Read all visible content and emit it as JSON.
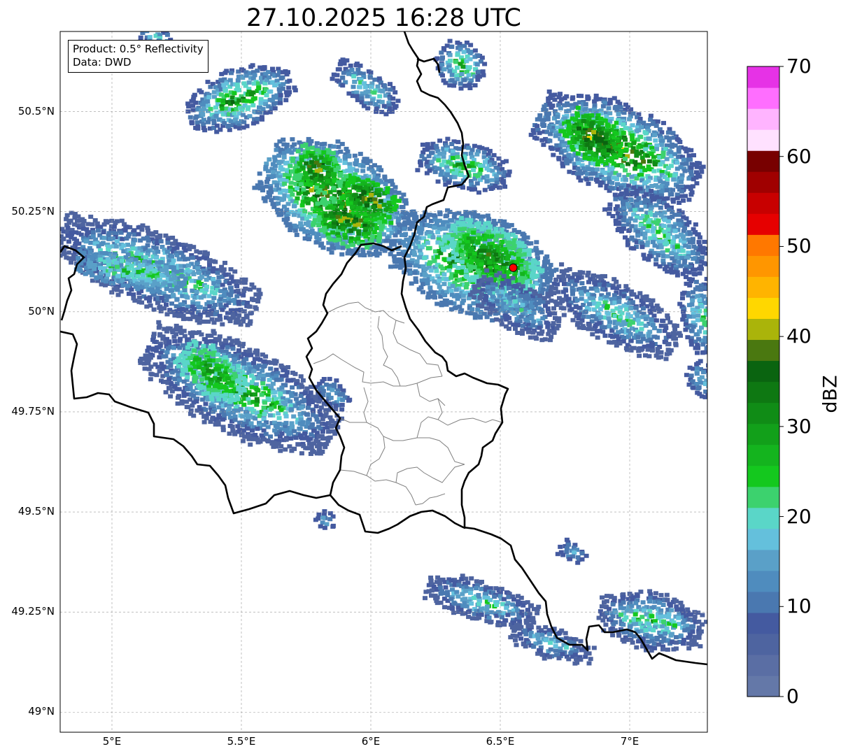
{
  "title": "27.10.2025 16:28 UTC",
  "info_box": {
    "product": "Product: 0.5° Reflectivity",
    "data_source": "Data: DWD"
  },
  "map": {
    "projection": "PlateCarree",
    "lon_range": [
      4.8,
      7.3
    ],
    "lat_range": [
      48.95,
      50.7
    ],
    "gridlines": true,
    "lat_ticks": [
      {
        "value": 49.0,
        "label": "49°N"
      },
      {
        "value": 49.25,
        "label": "49.25°N"
      },
      {
        "value": 49.5,
        "label": "49.5°N"
      },
      {
        "value": 49.75,
        "label": "49.75°N"
      },
      {
        "value": 50.0,
        "label": "50°N"
      },
      {
        "value": 50.25,
        "label": "50.25°N"
      },
      {
        "value": 50.5,
        "label": "50.5°N"
      }
    ],
    "lon_ticks": [
      {
        "value": 5.0,
        "label": "5°E"
      },
      {
        "value": 5.5,
        "label": "5.5°E"
      },
      {
        "value": 6.0,
        "label": "6°E"
      },
      {
        "value": 6.5,
        "label": "6.5°E"
      },
      {
        "value": 7.0,
        "label": "7°E"
      }
    ],
    "radar_site": {
      "lon": 6.55,
      "lat": 50.11,
      "color": "#ff0000"
    },
    "country_border_color": "#000000",
    "district_border_color": "#808080"
  },
  "colorbar": {
    "label": "dBZ",
    "range": [
      0,
      70
    ],
    "step": 2.5,
    "ticks": [
      {
        "value": 0,
        "label": "0"
      },
      {
        "value": 10,
        "label": "10"
      },
      {
        "value": 20,
        "label": "20"
      },
      {
        "value": 30,
        "label": "30"
      },
      {
        "value": 40,
        "label": "40"
      },
      {
        "value": 50,
        "label": "50"
      },
      {
        "value": 60,
        "label": "60"
      },
      {
        "value": 70,
        "label": "70"
      }
    ],
    "colors": [
      "#6478a8",
      "#5a6ea4",
      "#4e64a0",
      "#445aa0",
      "#4a78b0",
      "#4f8cbe",
      "#5aa0c8",
      "#64c0dc",
      "#5ad6c8",
      "#3cd26e",
      "#14c81e",
      "#14b41e",
      "#12a01a",
      "#108c16",
      "#0e7812",
      "#0a6410",
      "#4a7810",
      "#aab40a",
      "#ffd700",
      "#ffb400",
      "#ff9600",
      "#ff7800",
      "#e60000",
      "#c80000",
      "#a00000",
      "#780000",
      "#ffe1ff",
      "#ffb4ff",
      "#ff6eff",
      "#e632e6"
    ]
  }
}
